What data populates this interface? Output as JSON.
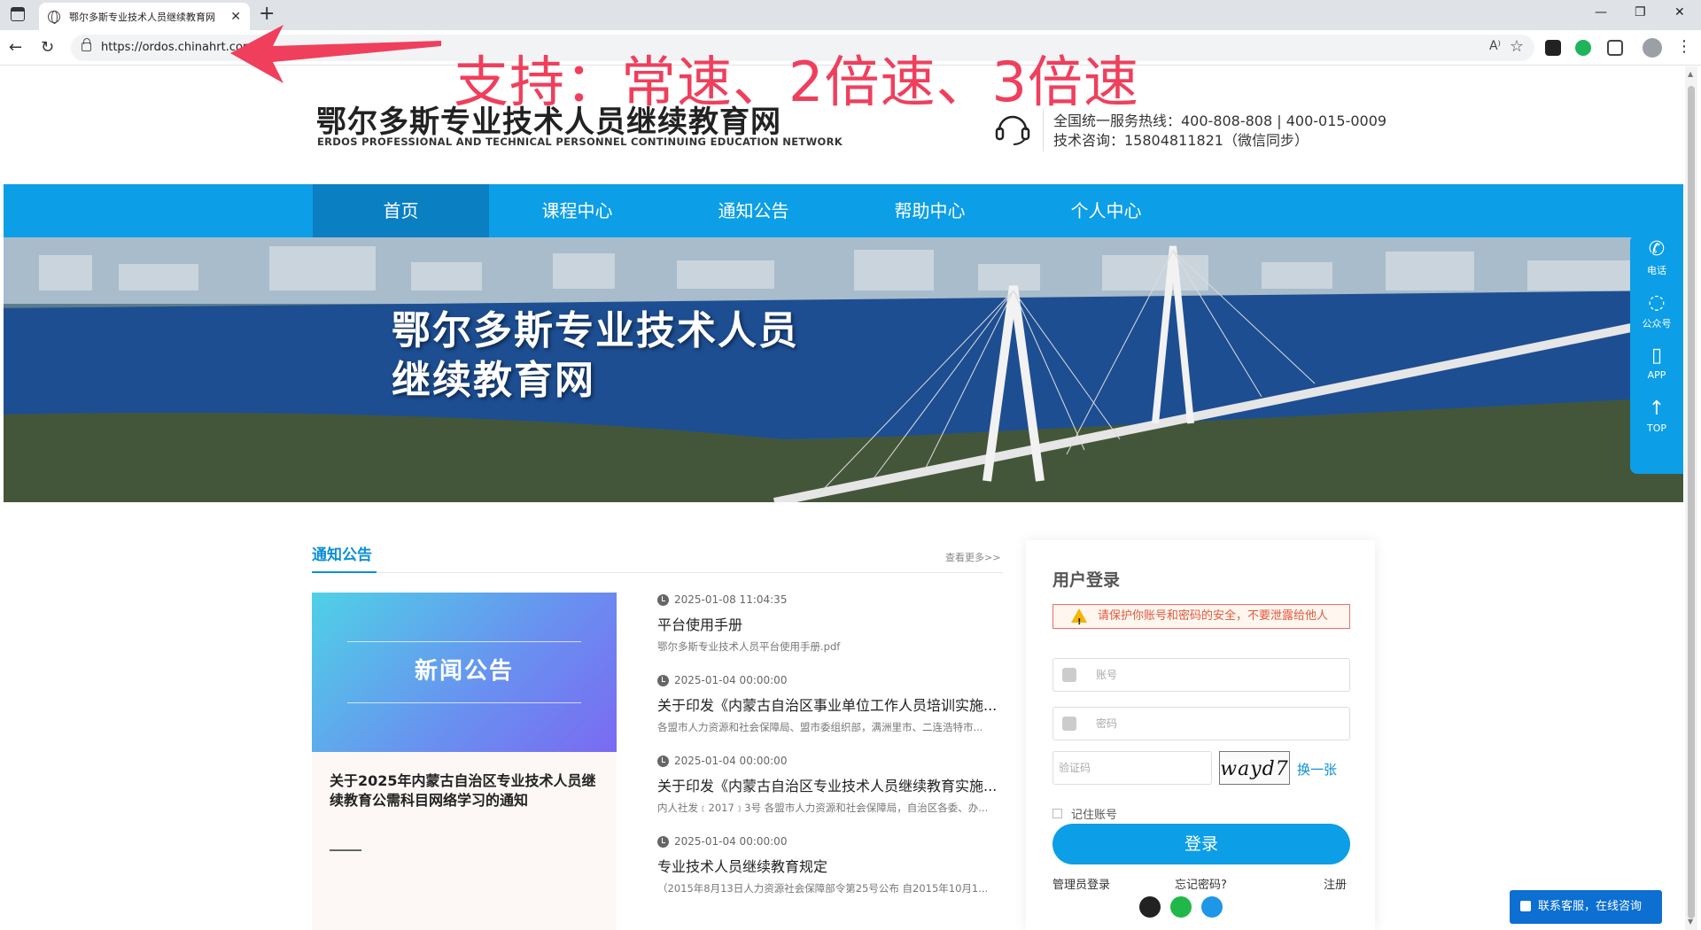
{
  "browser": {
    "tab_title": "鄂尔多斯专业技术人员继续教育网",
    "url": "https://ordos.chinahrt.com",
    "read_aloud": "A⁾",
    "minimize": "—",
    "restore": "❐",
    "close": "✕"
  },
  "annotation": {
    "text": "支持：常速、2倍速、3倍速",
    "color": "#ef3f5c"
  },
  "header": {
    "site_title": "鄂尔多斯专业技术人员继续教育网",
    "site_subtitle": "ERDOS PROFESSIONAL AND TECHNICAL PERSONNEL CONTINUING EDUCATION NETWORK",
    "hotline": "全国统一服务热线：400-808-808 | 400-015-0009",
    "tech_support": "技术咨询：15804811821（微信同步）"
  },
  "nav": {
    "items": [
      {
        "label": "首页",
        "active": true
      },
      {
        "label": "课程中心",
        "active": false
      },
      {
        "label": "通知公告",
        "active": false
      },
      {
        "label": "帮助中心",
        "active": false
      },
      {
        "label": "个人中心",
        "active": false
      }
    ]
  },
  "banner": {
    "line1": "鄂尔多斯专业技术人员",
    "line2": "继续教育网"
  },
  "side_tools": [
    {
      "label": "电话",
      "icon": "phone-icon"
    },
    {
      "label": "公众号",
      "icon": "wechat-icon"
    },
    {
      "label": "APP",
      "icon": "mobile-icon"
    },
    {
      "label": "TOP",
      "icon": "arrow-up-icon"
    }
  ],
  "notices": {
    "heading": "通知公告",
    "more": "查看更多>>",
    "card": {
      "image_text": "新闻公告",
      "title": "关于2025年内蒙古自治区专业技术人员继续教育公需科目网络学习的通知"
    },
    "items": [
      {
        "time": "2025-01-08 11:04:35",
        "title": "平台使用手册",
        "desc": "鄂尔多斯专业技术人员平台使用手册.pdf"
      },
      {
        "time": "2025-01-04 00:00:00",
        "title": "关于印发《内蒙古自治区事业单位工作人员培训实施...",
        "desc": "各盟市人力资源和社会保障局、盟市委组织部，满洲里市、二连浩特市..."
      },
      {
        "time": "2025-01-04 00:00:00",
        "title": "关于印发《内蒙古自治区专业技术人员继续教育实施...",
        "desc": "内人社发﹝2017﹞3号 各盟市人力资源和社会保障局，自治区各委、办..."
      },
      {
        "time": "2025-01-04 00:00:00",
        "title": "专业技术人员继续教育规定",
        "desc": "（2015年8月13日人力资源社会保障部令第25号公布 自2015年10月1..."
      }
    ]
  },
  "login": {
    "title": "用户登录",
    "warning": "请保护你账号和密码的安全，不要泄露给他人",
    "account_placeholder": "账号",
    "password_placeholder": "密码",
    "captcha_placeholder": "验证码",
    "captcha_code": "wayd7",
    "refresh": "换一张",
    "remember": "记住账号",
    "submit": "登录",
    "admin_login": "管理员登录",
    "forgot": "忘记密码?",
    "register": "注册"
  },
  "contact": {
    "label": "联系客服，在线咨询"
  },
  "colors": {
    "primary": "#0c9ee6",
    "nav_active": "#0a7fc2",
    "link": "#0c8fd7",
    "warning_text": "#e25b3a"
  }
}
